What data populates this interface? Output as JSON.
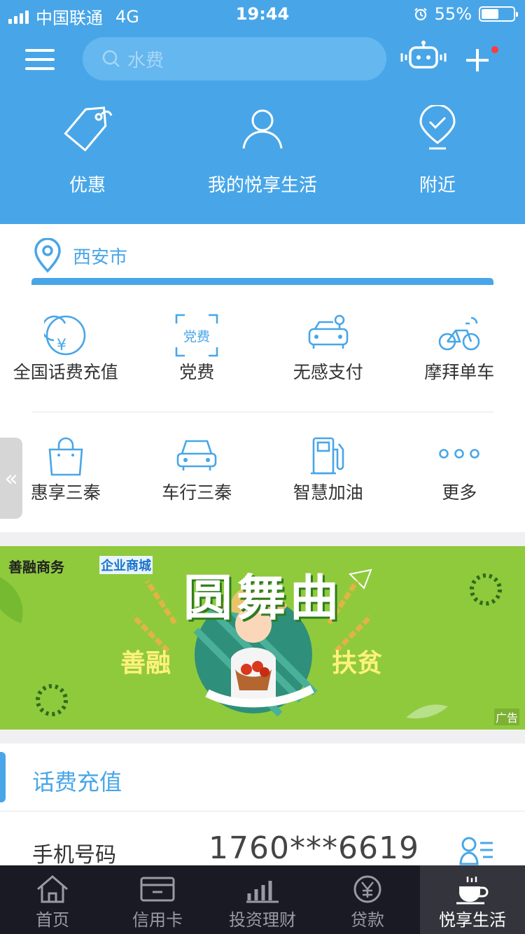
{
  "status_bar": {
    "carrier": "中国联通",
    "network": "4G",
    "time": "19:44",
    "battery_percent": "55%",
    "battery_level": 0.55
  },
  "header": {
    "search_placeholder": "水费",
    "nav": [
      {
        "label": "优惠",
        "icon": "tag-icon"
      },
      {
        "label": "我的悦享生活",
        "icon": "user-icon"
      },
      {
        "label": "附近",
        "icon": "location-check-icon"
      }
    ]
  },
  "location": {
    "city": "西安市"
  },
  "services": {
    "row1": [
      {
        "label": "全国话费充值",
        "icon": "phone-recharge-icon"
      },
      {
        "label": "党费",
        "icon": "party-fee-icon",
        "icon_text": "党费"
      },
      {
        "label": "无感支付",
        "icon": "car-pay-icon"
      },
      {
        "label": "摩拜单车",
        "icon": "bike-icon"
      }
    ],
    "row2": [
      {
        "label": "惠享三秦",
        "icon": "shopping-bag-icon"
      },
      {
        "label": "车行三秦",
        "icon": "car-icon"
      },
      {
        "label": "智慧加油",
        "icon": "fuel-pump-icon"
      },
      {
        "label": "更多",
        "icon": "more-dots-icon"
      }
    ],
    "drawer_symbol": "«"
  },
  "banner": {
    "brand": "善融商务",
    "brand_sub": "企业商城",
    "title": "圆舞曲",
    "left_text": "善融",
    "right_text": "扶贫",
    "ad_label": "广告"
  },
  "topup": {
    "title": "话费充值",
    "phone_label": "手机号码",
    "phone_number": "1760***6619"
  },
  "tabbar": [
    {
      "label": "首页",
      "icon": "home-icon",
      "active": false
    },
    {
      "label": "信用卡",
      "icon": "credit-card-icon",
      "active": false
    },
    {
      "label": "投资理财",
      "icon": "bar-chart-icon",
      "active": false
    },
    {
      "label": "贷款",
      "icon": "yen-coin-icon",
      "active": false
    },
    {
      "label": "悦享生活",
      "icon": "coffee-cup-icon",
      "active": true
    }
  ],
  "colors": {
    "primary": "#48a6e8",
    "tabbar_bg": "#1a1a24",
    "banner_green": "#8fca3d",
    "badge_red": "#ff3b3b"
  }
}
